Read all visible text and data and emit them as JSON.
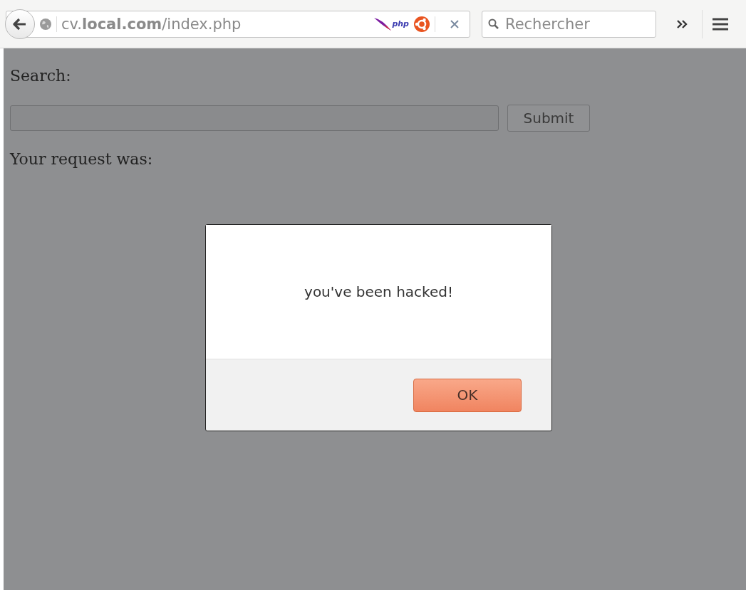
{
  "toolbar": {
    "url": "cv.**local.com**/index.php",
    "php_badge": "php",
    "search": {
      "placeholder": "Rechercher"
    }
  },
  "page": {
    "search_label": "Search:",
    "submit_button": "Submit",
    "request_label": "Your request was:"
  },
  "dialog": {
    "message": "you've been hacked!",
    "ok_button": "OK"
  }
}
